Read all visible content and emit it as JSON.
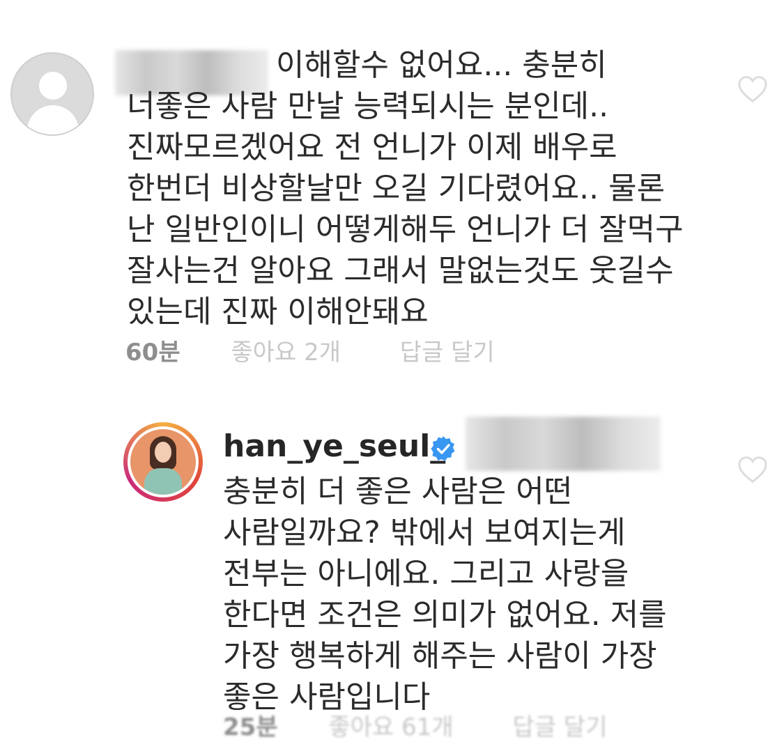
{
  "comments": [
    {
      "author_blurred": true,
      "avatar": "default-avatar-icon",
      "text_lines": [
        "이해할수 없어요... 충분히",
        "너좋은 사람 만날 능력되시는 분인데..",
        "진짜모르겠어요 전 언니가 이제 배우로",
        "한번더 비상할날만 오길 기다렸어요.. 물론",
        "난 일반인이니 어떻게해두 언니가 더 잘먹구",
        "잘사는건 알아요 그래서 말없는것도 웃길수",
        "있는데 진짜 이해안돼요"
      ],
      "time": "60분",
      "likes": "좋아요 2개",
      "reply": "답글 달기"
    },
    {
      "author": "han_ye_seul_",
      "verified": true,
      "mention_blurred": true,
      "text_lines": [
        "충분히 더 좋은 사람은 어떤",
        "사람일까요? 밖에서 보여지는게",
        "전부는 아니에요. 그리고 사랑을",
        "한다면 조건은 의미가 없어요. 저를",
        "가장 행복하게 해주는 사람이 가장",
        "좋은 사람입니다"
      ],
      "time": "25분",
      "likes": "좋아요 61개",
      "reply": "답글 달기"
    }
  ],
  "colors": {
    "text": "#262626",
    "meta": "#8e8e8e",
    "verified": "#3897f0",
    "heart": "#c7c7c7"
  }
}
